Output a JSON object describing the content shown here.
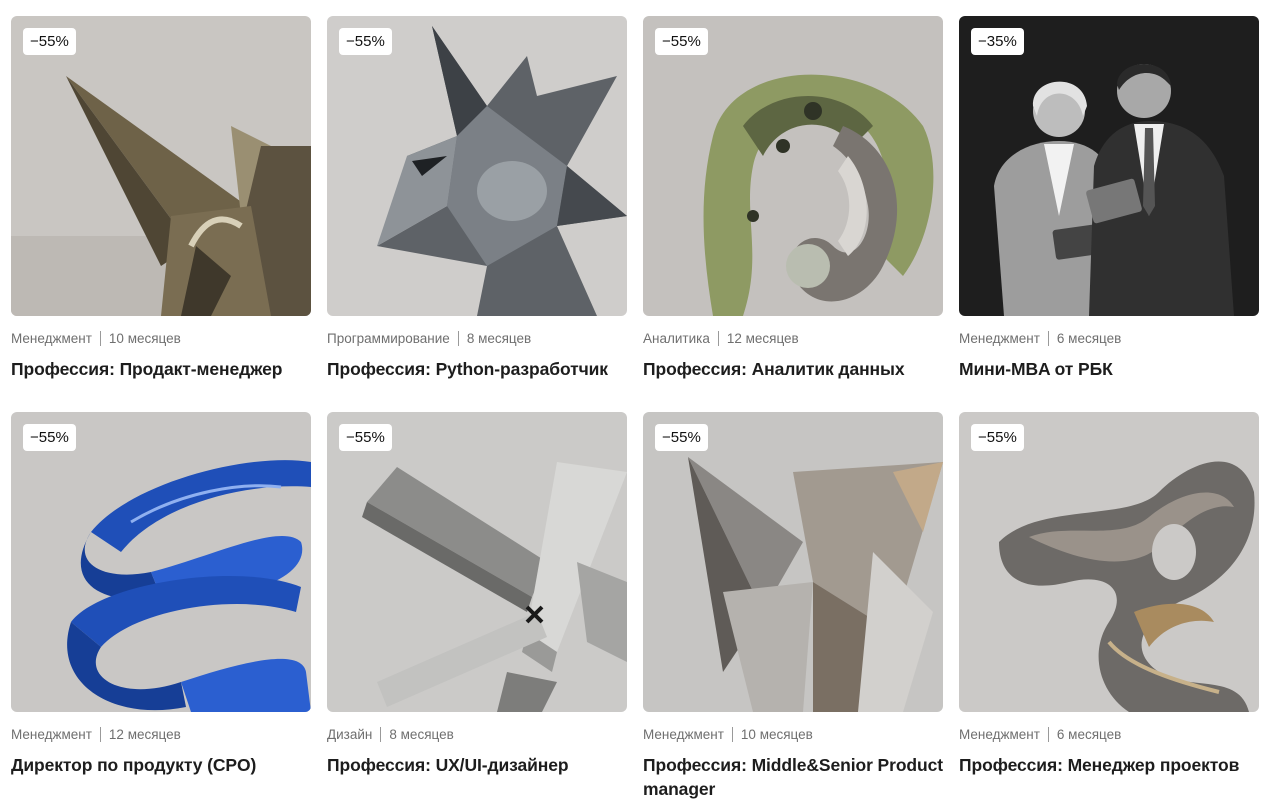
{
  "courses": [
    {
      "discount": "−55%",
      "category": "Менеджмент",
      "duration": "10 месяцев",
      "title": "Профессия: Продакт-менеджер",
      "image": "bronze-triangles-sculpture"
    },
    {
      "discount": "−55%",
      "category": "Программирование",
      "duration": "8 месяцев",
      "title": "Профессия: Python-разработчик",
      "image": "metal-star-sculpture"
    },
    {
      "discount": "−55%",
      "category": "Аналитика",
      "duration": "12 месяцев",
      "title": "Профессия: Аналитик данных",
      "image": "marble-ribbon-sculpture"
    },
    {
      "discount": "−35%",
      "category": "Менеджмент",
      "duration": "6 месяцев",
      "title": "Мини-MBA от РБК",
      "image": "business-people-with-tablets-photo"
    },
    {
      "discount": "−55%",
      "category": "Менеджмент",
      "duration": "12 месяцев",
      "title": "Директор по продукту (CPO)",
      "image": "blue-ribbon-sculpture"
    },
    {
      "discount": "−55%",
      "category": "Дизайн",
      "duration": "8 месяцев",
      "title": "Профессия: UX/UI-дизайнер",
      "image": "steel-bars-sculpture"
    },
    {
      "discount": "−55%",
      "category": "Менеджмент",
      "duration": "10 месяцев",
      "title": "Профессия: Middle&Senior Product manager",
      "image": "steel-prisms-sculpture"
    },
    {
      "discount": "−55%",
      "category": "Менеджмент",
      "duration": "6 месяцев",
      "title": "Профессия: Менеджер проектов",
      "image": "twisted-metal-sculpture"
    }
  ]
}
